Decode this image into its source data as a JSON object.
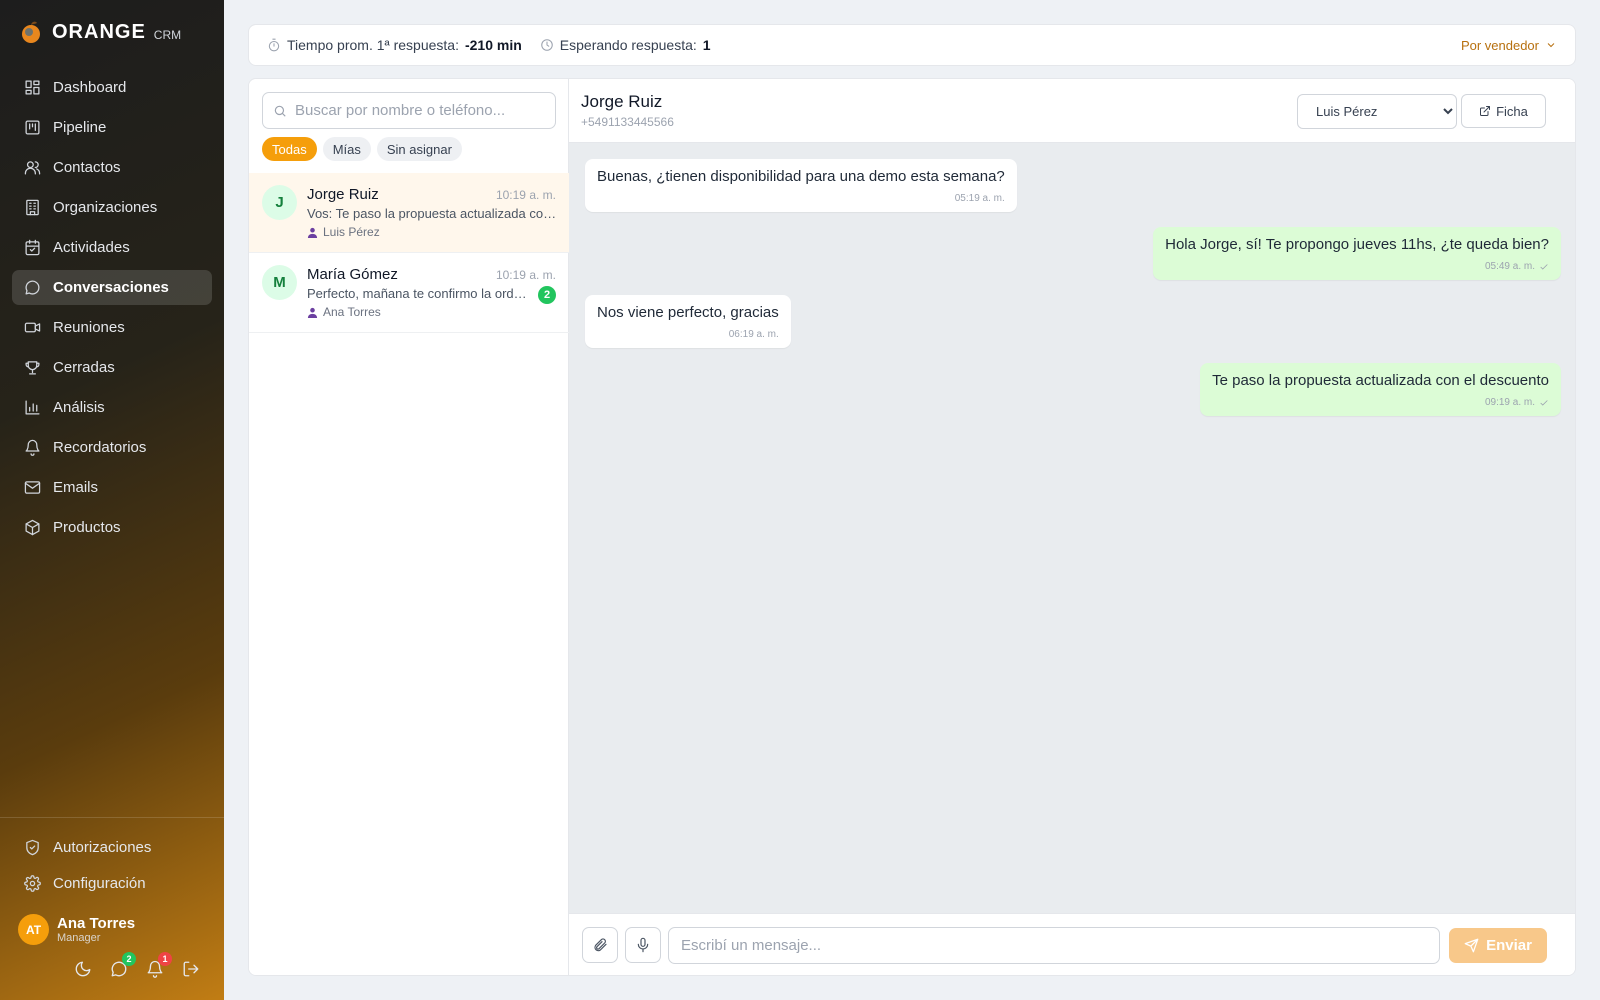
{
  "brand": {
    "name": "ORANGE",
    "sub": "CRM"
  },
  "nav": [
    {
      "label": "Dashboard",
      "icon": "dashboard-icon"
    },
    {
      "label": "Pipeline",
      "icon": "pipeline-icon"
    },
    {
      "label": "Contactos",
      "icon": "users-icon"
    },
    {
      "label": "Organizaciones",
      "icon": "building-icon"
    },
    {
      "label": "Actividades",
      "icon": "calendar-icon"
    },
    {
      "label": "Conversaciones",
      "icon": "chat-icon",
      "active": true
    },
    {
      "label": "Reuniones",
      "icon": "video-icon"
    },
    {
      "label": "Cerradas",
      "icon": "trophy-icon"
    },
    {
      "label": "Análisis",
      "icon": "bar-chart-icon"
    },
    {
      "label": "Recordatorios",
      "icon": "bell-icon"
    },
    {
      "label": "Emails",
      "icon": "mail-icon"
    },
    {
      "label": "Productos",
      "icon": "box-icon"
    }
  ],
  "nav_bottom": [
    {
      "label": "Autorizaciones",
      "icon": "shield-icon"
    },
    {
      "label": "Configuración",
      "icon": "gear-icon"
    }
  ],
  "user": {
    "initials": "AT",
    "name": "Ana Torres",
    "role": "Manager"
  },
  "side_badges": {
    "chat": "2",
    "bell": "1"
  },
  "stats": {
    "response_label": "Tiempo prom. 1ª respuesta:",
    "response_value": "-210 min",
    "waiting_label": "Esperando respuesta:",
    "waiting_value": "1",
    "vendor_filter": "Por vendedor"
  },
  "search": {
    "placeholder": "Buscar por nombre o teléfono..."
  },
  "filters": [
    {
      "label": "Todas",
      "active": true
    },
    {
      "label": "Mías"
    },
    {
      "label": "Sin asignar"
    }
  ],
  "conversations": [
    {
      "initial": "J",
      "name": "Jorge Ruiz",
      "time": "10:19 a. m.",
      "preview": "Vos: Te paso la propuesta actualizada con el descuento",
      "owner": "Luis Pérez",
      "active": true
    },
    {
      "initial": "M",
      "name": "María Gómez",
      "time": "10:19 a. m.",
      "preview": "Perfecto, mañana te confirmo la orden",
      "owner": "Ana Torres",
      "unread": "2"
    }
  ],
  "chat": {
    "contact_name": "Jorge Ruiz",
    "contact_phone": "+5491133445566",
    "assigned": "Luis Pérez",
    "ficha_label": "Ficha",
    "messages": [
      {
        "dir": "in",
        "text": "Buenas, ¿tienen disponibilidad para una demo esta semana?",
        "time": "05:19 a. m."
      },
      {
        "dir": "out",
        "text": "Hola Jorge, sí! Te propongo jueves 11hs, ¿te queda bien?",
        "time": "05:49 a. m."
      },
      {
        "dir": "in",
        "text": "Nos viene perfecto, gracias",
        "time": "06:19 a. m."
      },
      {
        "dir": "out",
        "text": "Te paso la propuesta actualizada con el descuento",
        "time": "09:19 a. m."
      }
    ],
    "input_placeholder": "Escribí un mensaje...",
    "send_label": "Enviar"
  },
  "colors": {
    "accent": "#f59e0b",
    "unread": "#22c55e",
    "outgoing": "#dcfcd6"
  }
}
